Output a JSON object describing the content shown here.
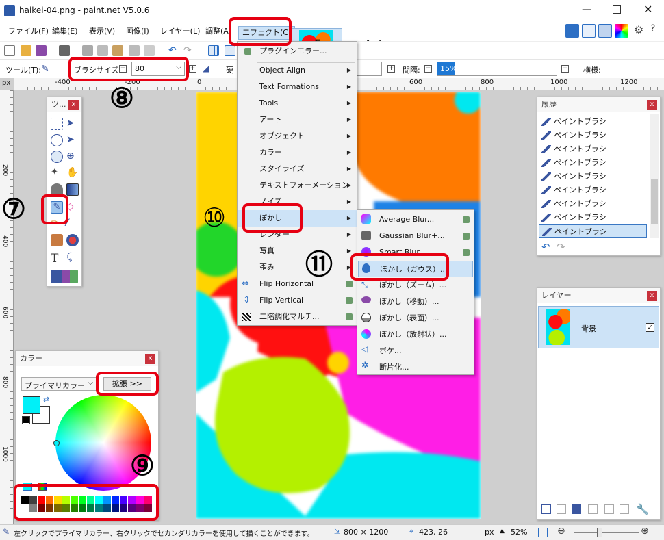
{
  "window": {
    "title": "haikei-04.png - paint.net V5.0.6"
  },
  "menu": {
    "items": [
      "ファイル(F)",
      "編集(E)",
      "表示(V)",
      "画像(I)",
      "レイヤー(L)",
      "調整(A)",
      "エフェクト(C)"
    ]
  },
  "annotation": {
    "title": "「エフェクト」",
    "n7": "⑦",
    "n8": "⑧",
    "n9": "⑨",
    "n10": "⑩",
    "n11": "⑪"
  },
  "toolbar": {
    "tool_label": "ツール(T):",
    "brush_size_label": "ブラシサイズ:",
    "brush_size_value": "80",
    "hardness_label": "硬",
    "spacing_label": "間隔:",
    "spacing_value": "15%",
    "mode_label": "横様:"
  },
  "ruler": {
    "h": [
      "-400",
      "-200",
      "0",
      "200",
      "400",
      "600",
      "800",
      "1000",
      "1200"
    ],
    "v": [
      "200",
      "400",
      "600",
      "800",
      "1000"
    ],
    "unit": "px"
  },
  "effects_menu": {
    "items": [
      "プラグインエラー...",
      "Object Align",
      "Text Formations",
      "Tools",
      "アート",
      "オブジェクト",
      "カラー",
      "スタイライズ",
      "テキストフォーメーション",
      "ノイズ",
      "ぼかし",
      "レンダー",
      "写真",
      "歪み",
      "Flip Horizontal",
      "Flip Vertical",
      "二階調化マルチ..."
    ]
  },
  "blur_menu": {
    "items": [
      "Average Blur...",
      "Gaussian Blur+...",
      "Smart Blur...",
      "ぼかし（ガウス）...",
      "ぼかし（ズーム）...",
      "ぼかし（移動）...",
      "ぼかし（表面）...",
      "ぼかし（放射状）...",
      "ボケ...",
      "断片化..."
    ]
  },
  "tools_panel": {
    "title": "ツ..."
  },
  "history_panel": {
    "title": "履歴",
    "items": [
      "ペイントブラシ",
      "ペイントブラシ",
      "ペイントブラシ",
      "ペイントブラシ",
      "ペイントブラシ",
      "ペイントブラシ",
      "ペイントブラシ",
      "ペイントブラシ",
      "ペイントブラシ"
    ]
  },
  "layers_panel": {
    "title": "レイヤー",
    "layer_name": "背景"
  },
  "colors_panel": {
    "title": "カラー",
    "primary_select": "プライマリカラー",
    "expand_button": "拡張 >>",
    "primary_color": "#00f0f8"
  },
  "status": {
    "hint": "左クリックでプライマリカラー、右クリックでセカンダリカラーを使用して描くことができます。",
    "image_size": "800 × 1200",
    "cursor": "423, 26",
    "unit": "px",
    "zoom": "52%"
  }
}
